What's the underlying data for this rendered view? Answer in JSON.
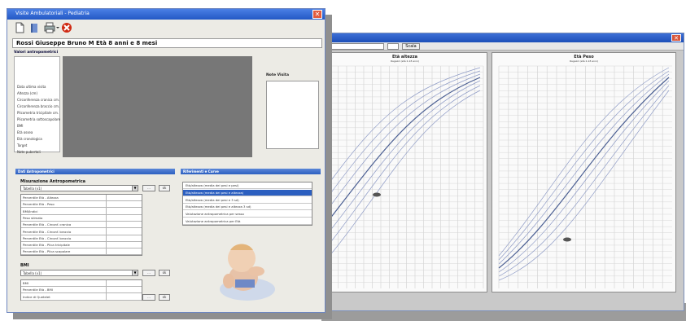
{
  "back_window": {
    "close_glyph": "✕",
    "toolbar_button": "Scala",
    "left_chart": {
      "title": "Età altezza",
      "subtitle": "Ragazzi (età 2-18 anni)"
    },
    "right_chart": {
      "title": "Età Peso",
      "subtitle": "Ragazzi (età 2-18 anni)"
    }
  },
  "front_window": {
    "title": "Visite Ambulatoriali - Pediatria",
    "close_glyph": "✕",
    "patient_name": "Rossi Giuseppe Bruno M Età 8 anni e 8 mesi",
    "section_top": "Valori antropometrici",
    "info_lines": [
      "Data ultima visita",
      "Altezza (cm)",
      "Circonferenza cranica cm.",
      "Circonferenza braccio cm.",
      "Plicometria tricipitale cm.",
      "Plicometria sottoscapolare",
      "BMI",
      "Età ossea",
      "Età cronologica",
      "Target",
      "Note pubertali"
    ],
    "notes_label": "Note Visita",
    "section_left": "Dati Antropometrici",
    "section_right": "Riferimenti e Curve",
    "measure_title": "Misurazione Antropometrica",
    "measure_combo": "Tabella (v1)",
    "measure_rows": [
      "Percentile Età - Altezza",
      "Percentile Età - Peso",
      "BMI/Indici",
      "Peso stimato",
      "Percentile Età - Circonf. cranica",
      "Percentile Età - Circonf. braccio",
      "Percentile Età - Circonf. braccio",
      "Percentile Età - Plica tricipitale",
      "Percentile Età - Plica scapolare"
    ],
    "curve_items": [
      "Età/altezza (media dei pesi e pesi)",
      "Età/altezza (media dei pesi e altezza)",
      "Età/altezza (media dei pesi e 3 sd)",
      "Età/altezza (media dei pesi e altezza 3 sd)",
      "Valutazione antropometrica per sesso",
      "Valutazione antropometrica per Età"
    ],
    "curve_selected_index": 1,
    "cs_label": "BMI",
    "cs_combo": "Tabella (v1)",
    "cs_rows": [
      "BMI",
      "Percentile Età - BMI",
      "Indice di Quetelet"
    ],
    "btn_small": "...",
    "btn_go": "ok"
  },
  "colors": {
    "titlebar": "#2358c5",
    "selection": "#2c5fc0",
    "image_area": "#777777"
  },
  "icons": [
    "new-document-icon",
    "open-icon",
    "print-icon",
    "delete-icon"
  ]
}
